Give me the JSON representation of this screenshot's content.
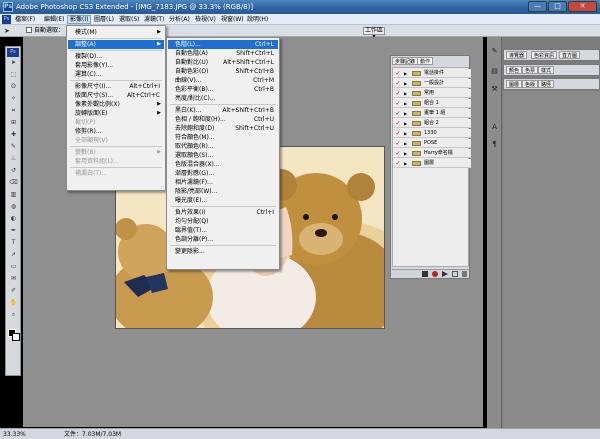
{
  "window": {
    "app_icon": "Ps",
    "title": "Adobe Photoshop CS3 Extended - [IMG_7183.JPG @ 33.3% (RGB/8)]",
    "min_label": "—",
    "max_label": "□",
    "close_label": "✕"
  },
  "menubar": [
    {
      "name": "menu-file",
      "label": "檔案(F)"
    },
    {
      "name": "menu-edit",
      "label": "編輯(E)"
    },
    {
      "name": "menu-image",
      "label": "影像(I)",
      "active": true
    },
    {
      "name": "menu-layer",
      "label": "圖層(L)"
    },
    {
      "name": "menu-select",
      "label": "選取(S)"
    },
    {
      "name": "menu-filter",
      "label": "濾鏡(T)"
    },
    {
      "name": "menu-analysis",
      "label": "分析(A)"
    },
    {
      "name": "menu-view",
      "label": "檢視(V)"
    },
    {
      "name": "menu-window",
      "label": "視窗(W)"
    },
    {
      "name": "menu-help",
      "label": "說明(H)"
    }
  ],
  "options": {
    "auto_select": "自動選取：",
    "workspace": "工作區 ▾"
  },
  "image_menu": [
    {
      "label": "模式(M)",
      "arrow": "▶"
    },
    {
      "sep": true
    },
    {
      "label": "調整(A)",
      "arrow": "▶",
      "highlight": true
    },
    {
      "sep": true
    },
    {
      "label": "複製(D)..."
    },
    {
      "label": "套用影像(Y)..."
    },
    {
      "label": "運算(C)..."
    },
    {
      "sep": true
    },
    {
      "label": "影像尺寸(I)...",
      "shortcut": "Alt+Ctrl+I"
    },
    {
      "label": "版面尺寸(S)...",
      "shortcut": "Alt+Ctrl+C"
    },
    {
      "label": "像素外觀比例(X)",
      "arrow": "▶"
    },
    {
      "label": "旋轉版面(E)",
      "arrow": "▶"
    },
    {
      "label": "裁切(P)",
      "disabled": true
    },
    {
      "label": "修剪(R)..."
    },
    {
      "label": "全部顯現(V)",
      "disabled": true
    },
    {
      "sep": true
    },
    {
      "label": "變數(B)",
      "arrow": "▶",
      "disabled": true
    },
    {
      "label": "套用資料組(L)...",
      "disabled": true
    },
    {
      "sep": true
    },
    {
      "label": "補漏白(T)...",
      "disabled": true
    }
  ],
  "adjust_menu": [
    {
      "label": "色階(L)...",
      "shortcut": "Ctrl+L",
      "highlight": true
    },
    {
      "label": "自動色階(A)",
      "shortcut": "Shift+Ctrl+L"
    },
    {
      "label": "自動對比(U)",
      "shortcut": "Alt+Shift+Ctrl+L"
    },
    {
      "label": "自動色彩(O)",
      "shortcut": "Shift+Ctrl+B"
    },
    {
      "label": "曲線(V)...",
      "shortcut": "Ctrl+M"
    },
    {
      "label": "色彩平衡(B)...",
      "shortcut": "Ctrl+B"
    },
    {
      "label": "亮度/對比(C)..."
    },
    {
      "sep": true
    },
    {
      "label": "黑白(K)...",
      "shortcut": "Alt+Shift+Ctrl+B"
    },
    {
      "label": "色相 / 飽和度(H)...",
      "shortcut": "Ctrl+U"
    },
    {
      "label": "去除飽和度(D)",
      "shortcut": "Shift+Ctrl+U"
    },
    {
      "label": "符合顏色(M)..."
    },
    {
      "label": "取代顏色(R)..."
    },
    {
      "label": "選取顏色(S)..."
    },
    {
      "label": "色版混合器(X)..."
    },
    {
      "label": "漸層對應(G)..."
    },
    {
      "label": "相片濾鏡(F)..."
    },
    {
      "label": "陰影/亮部(W)..."
    },
    {
      "label": "曝光度(E)..."
    },
    {
      "sep": true
    },
    {
      "label": "負片效果(I)",
      "shortcut": "Ctrl+I"
    },
    {
      "label": "均勻分配(Q)"
    },
    {
      "label": "臨界值(T)..."
    },
    {
      "label": "色調分離(P)..."
    },
    {
      "sep": true
    },
    {
      "label": "變更陰影..."
    }
  ],
  "layers_panel": {
    "tabs": [
      "步驟記錄",
      "動作"
    ],
    "layers": [
      {
        "name": "電話掛件",
        "checked": true
      },
      {
        "name": "一般設計",
        "checked": true
      },
      {
        "name": "常用",
        "checked": true
      },
      {
        "name": "組合 1",
        "checked": true
      },
      {
        "name": "畫筆 1 組",
        "checked": true
      },
      {
        "name": "組合 2",
        "checked": true
      },
      {
        "name": "1330",
        "checked": true
      },
      {
        "name": "POSE",
        "checked": true
      },
      {
        "name": "Harry命名檔",
        "checked": true
      },
      {
        "name": "圖層",
        "checked": true
      }
    ]
  },
  "dock_top": {
    "tabs": [
      "導覽器",
      "色彩資訊",
      "直方圖"
    ]
  },
  "dock_mid": {
    "tabs": [
      "顏色",
      "色票",
      "樣式"
    ]
  },
  "dock_bot": {
    "tabs": [
      "圖層",
      "色版",
      "路徑"
    ]
  },
  "status": {
    "zoom": "33.33%",
    "doc_size": "文件：7.03M/7.03M"
  },
  "icons": {
    "toolbox": [
      "move",
      "marquee",
      "lasso",
      "quick-select",
      "crop",
      "slice",
      "heal",
      "brush",
      "stamp",
      "history-brush",
      "eraser",
      "gradient",
      "blur",
      "dodge",
      "pen",
      "type",
      "path-select",
      "shape",
      "notes",
      "eyedropper",
      "hand",
      "zoom"
    ],
    "dock": [
      "brush-icon",
      "layers-icon",
      "tool-presets-icon",
      "character-icon",
      "paragraph-icon"
    ]
  },
  "colors": {
    "titlebar": "#2f62a0",
    "menu_highlight": "#1f6fd1",
    "workspace": "#8f8f8f"
  }
}
